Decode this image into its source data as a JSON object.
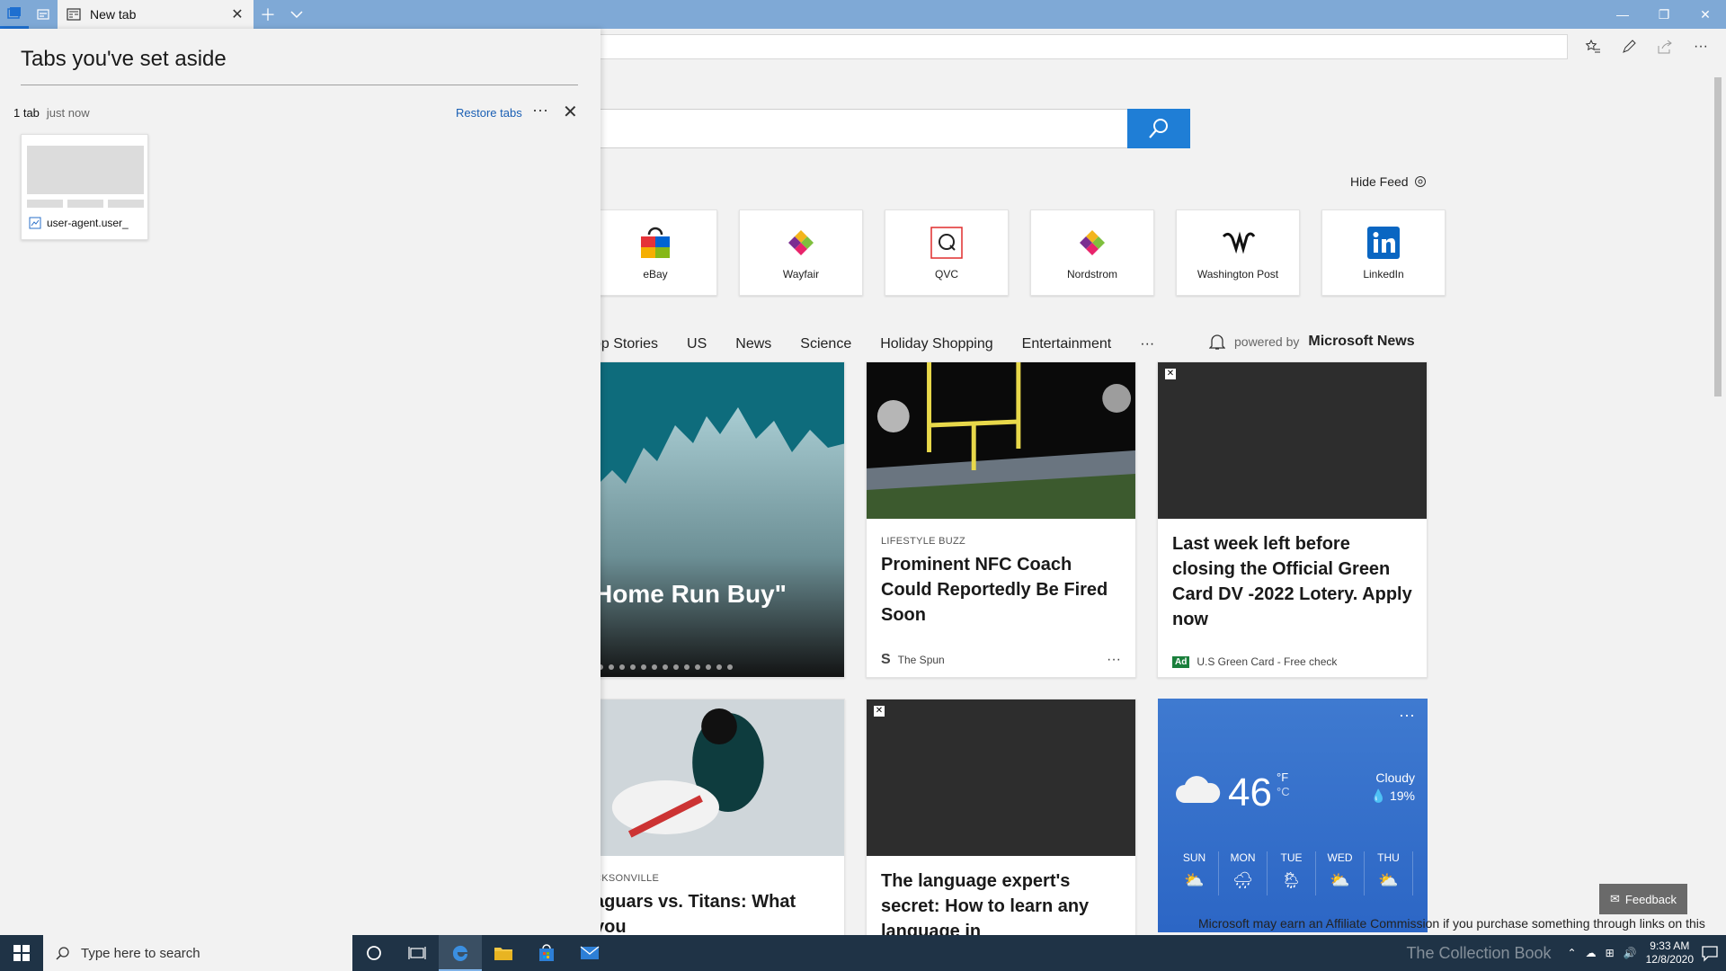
{
  "browser": {
    "tab_title": "New tab",
    "window_controls": [
      "minimize",
      "restore",
      "close"
    ]
  },
  "aside_panel": {
    "title": "Tabs you've set aside",
    "count_label": "1 tab",
    "time_label": "just now",
    "restore_label": "Restore tabs",
    "more_label": "···",
    "tab_item_label": "user-agent.user_"
  },
  "newtab": {
    "hide_feed_label": "Hide Feed",
    "tiles": [
      {
        "label": "eBay"
      },
      {
        "label": "Wayfair"
      },
      {
        "label": "QVC"
      },
      {
        "label": "Nordstrom"
      },
      {
        "label": "Washington Post"
      },
      {
        "label": "LinkedIn"
      }
    ],
    "categories": [
      "op Stories",
      "US",
      "News",
      "Science",
      "Holiday Shopping",
      "Entertainment",
      "···"
    ],
    "powered_prefix": "powered by",
    "powered_brand": "Microsoft News",
    "cards": {
      "hero_headline": "Home Run Buy\"",
      "nfc_source": "LIFESTYLE BUZZ",
      "nfc_headline": "Prominent NFC Coach Could Reportedly Be Fired Soon",
      "nfc_publisher": "The Spun",
      "greencard_headline": "Last week left before closing the Official Green Card DV -2022 Lotery. Apply now",
      "greencard_ad_badge": "Ad",
      "greencard_advertiser": "U.S Green Card - Free check",
      "jax_source": "CKSONVILLE",
      "jax_headline": "aguars vs. Titans: What you",
      "lang_headline": "The language expert's secret: How to learn any language in"
    },
    "weather": {
      "temp": "46",
      "unit_f": "°F",
      "unit_c": "°C",
      "condition": "Cloudy",
      "precip": "19%",
      "days": [
        "SUN",
        "MON",
        "TUE",
        "WED",
        "THU"
      ]
    },
    "feedback_label": "Feedback",
    "affiliate_note": "Microsoft may earn an Affiliate Commission if you purchase something through links on this page."
  },
  "taskbar": {
    "search_placeholder": "Type here to search",
    "time": "9:33 AM",
    "date": "12/8/2020",
    "watermark": "The Collection Book"
  },
  "colors": {
    "titlebar": "#7fa9d6",
    "accent_blue": "#1f7ed6",
    "taskbar": "#1f3346",
    "link": "#1a5fb4"
  }
}
